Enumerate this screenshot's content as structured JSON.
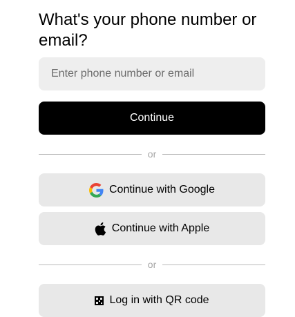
{
  "heading": "What's your phone number or email?",
  "input": {
    "placeholder": "Enter phone number or email",
    "value": ""
  },
  "continue_label": "Continue",
  "divider_label": "or",
  "google_label": "Continue with Google",
  "apple_label": "Continue with Apple",
  "qr_label": "Log in with QR code",
  "icons": {
    "google": "google-icon",
    "apple": "apple-icon",
    "qr": "qr-code-icon"
  },
  "colors": {
    "primary": "#000000",
    "secondary_bg": "#e8e8e8",
    "input_bg": "#eeeeee",
    "divider_text": "#a6a6a6"
  }
}
